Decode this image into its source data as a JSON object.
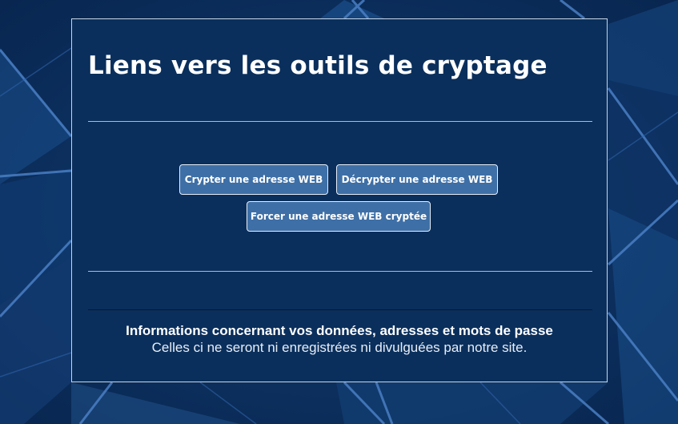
{
  "page": {
    "title": "Liens vers les outils de cryptage"
  },
  "buttons": {
    "encrypt": "Crypter une adresse WEB",
    "decrypt": "Décrypter une adresse WEB",
    "force": "Forcer une adresse WEB cryptée"
  },
  "info": {
    "title": "Informations concernant vos données, adresses et mots de passe",
    "text": "Celles ci ne seront ni enregistrées ni divulguées par notre site."
  },
  "colors": {
    "background": "#0b2f5e",
    "panel": "#0a2f5c",
    "button": "#3e6fa6",
    "accent_lines": "#4a7fc4"
  }
}
